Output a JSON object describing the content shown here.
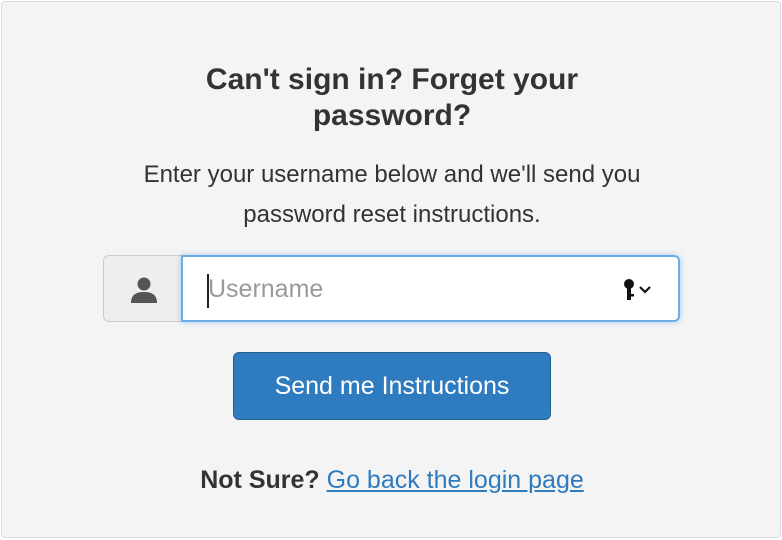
{
  "heading": "Can't sign in? Forget your password?",
  "instructions": "Enter your username below and we'll send you password reset instructions.",
  "username_field": {
    "placeholder": "Username",
    "value": "",
    "addon_icon": "user-icon",
    "autofill_icon": "key-icon"
  },
  "submit_label": "Send me Instructions",
  "footer": {
    "label": "Not Sure?",
    "link_text": "Go back the login page"
  },
  "colors": {
    "primary": "#2f7bbf",
    "panel_bg": "#f4f4f4",
    "focus_border": "#6aaee8",
    "text": "#333333"
  }
}
